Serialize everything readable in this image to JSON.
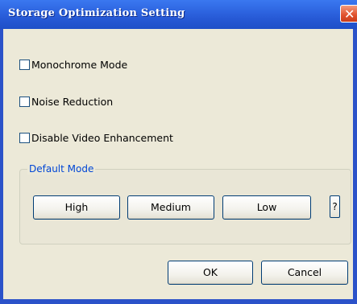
{
  "window": {
    "title": "Storage Optimization Setting",
    "close_glyph": "✕"
  },
  "options": {
    "monochrome_label": "Monochrome Mode",
    "monochrome_checked": false,
    "noise_label": "Noise Reduction",
    "noise_checked": false,
    "video_enh_label": "Disable Video Enhancement",
    "video_enh_checked": false
  },
  "default_mode": {
    "group_label": "Default Mode",
    "high_label": "High",
    "medium_label": "Medium",
    "low_label": "Low",
    "help_label": "?"
  },
  "actions": {
    "ok_label": "OK",
    "cancel_label": "Cancel"
  },
  "colors": {
    "titlebar": "#2557d3",
    "window_bg": "#ece9d8",
    "group_label": "#0046d5",
    "close_button": "#e0502c"
  }
}
